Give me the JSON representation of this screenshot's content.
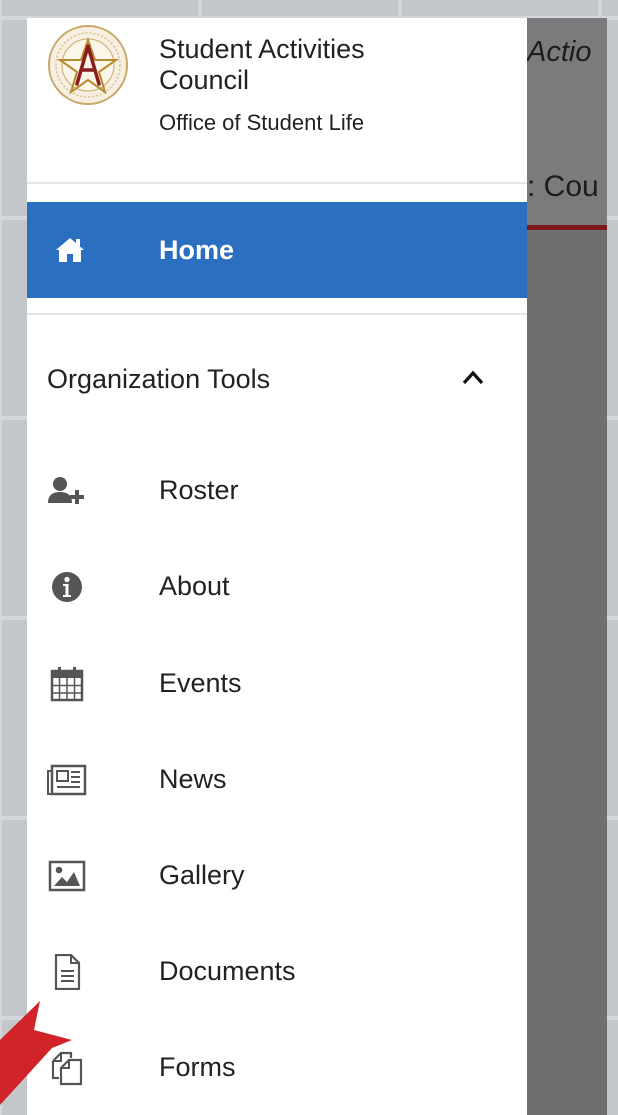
{
  "background_page": {
    "title_fragment": "Actio",
    "subtitle_fragment": ": Cou"
  },
  "drawer": {
    "org": {
      "name": "Student Activities Council",
      "subtitle": "Office of Student Life",
      "logo_icon": "pentagram-seal-logo"
    },
    "home": {
      "label": "Home",
      "icon": "home-icon",
      "color": "#2b6fc1"
    },
    "section": {
      "label": "Organization Tools",
      "expanded": true,
      "icon": "chevron-up-icon"
    },
    "items": [
      {
        "label": "Roster",
        "icon": "user-add-icon"
      },
      {
        "label": "About",
        "icon": "info-icon"
      },
      {
        "label": "Events",
        "icon": "calendar-icon"
      },
      {
        "label": "News",
        "icon": "newspaper-icon"
      },
      {
        "label": "Gallery",
        "icon": "image-icon"
      },
      {
        "label": "Documents",
        "icon": "document-icon"
      },
      {
        "label": "Forms",
        "icon": "forms-icon"
      }
    ]
  },
  "annotation": {
    "arrow_color": "#d1232a",
    "points_to": "Forms"
  }
}
